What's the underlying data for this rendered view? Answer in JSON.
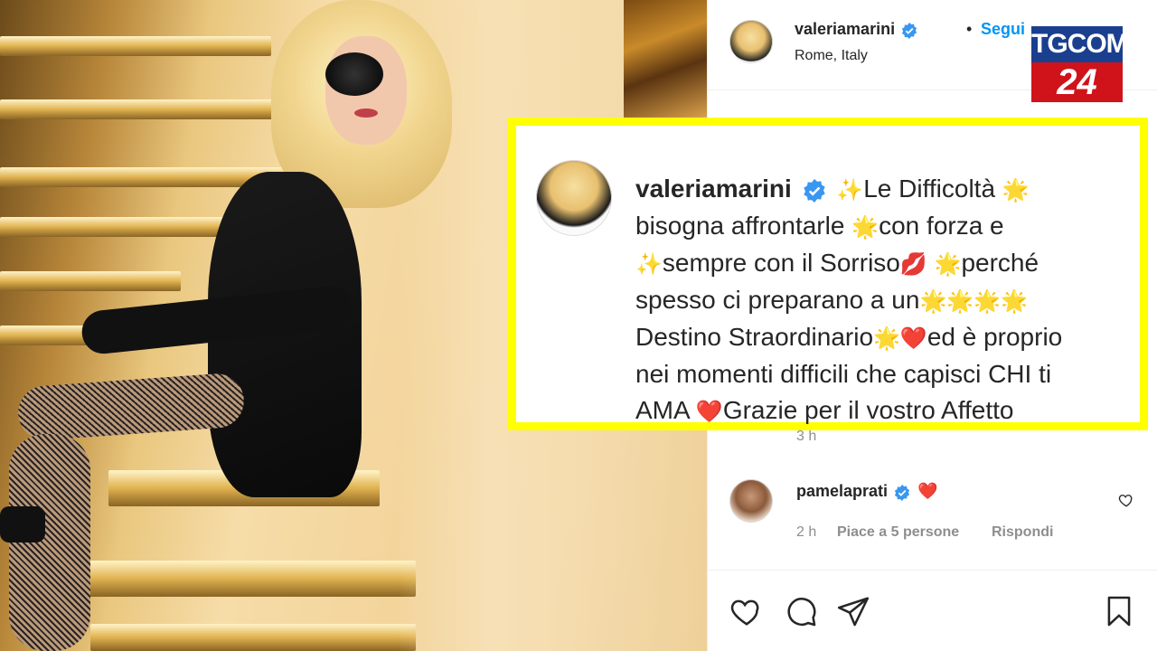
{
  "post": {
    "username": "valeriamarini",
    "follow_label": "Segui",
    "separator": "•",
    "location": "Rome, Italy",
    "caption_time": "3 h"
  },
  "caption": {
    "username": "valeriamarini",
    "line1": "Le Difficoltà",
    "line2a": "bisogna affrontarle",
    "line2b": "con forza e",
    "line3a": "sempre con il Sorriso",
    "line3b": "perché",
    "line4": "spesso ci preparano a un",
    "line5a": "Destino Straordinario",
    "line5b": "ed è proprio",
    "line6": "nei momenti difficili che capisci CHI ti",
    "line7a": "AMA",
    "line7b": "Grazie per il vostro Affetto"
  },
  "comment": {
    "username": "pamelaprati",
    "text": "❤️",
    "time": "2 h",
    "likes": "Piace a 5 persone",
    "reply": "Rispondi"
  },
  "watermark": {
    "top": "TGCOM",
    "bottom": "24"
  },
  "colors": {
    "link_blue": "#0095f6",
    "verified_blue": "#3897f0",
    "highlight_yellow": "#ffff00",
    "tgcom_blue": "#1b3f8f",
    "tgcom_red": "#d0121b"
  }
}
